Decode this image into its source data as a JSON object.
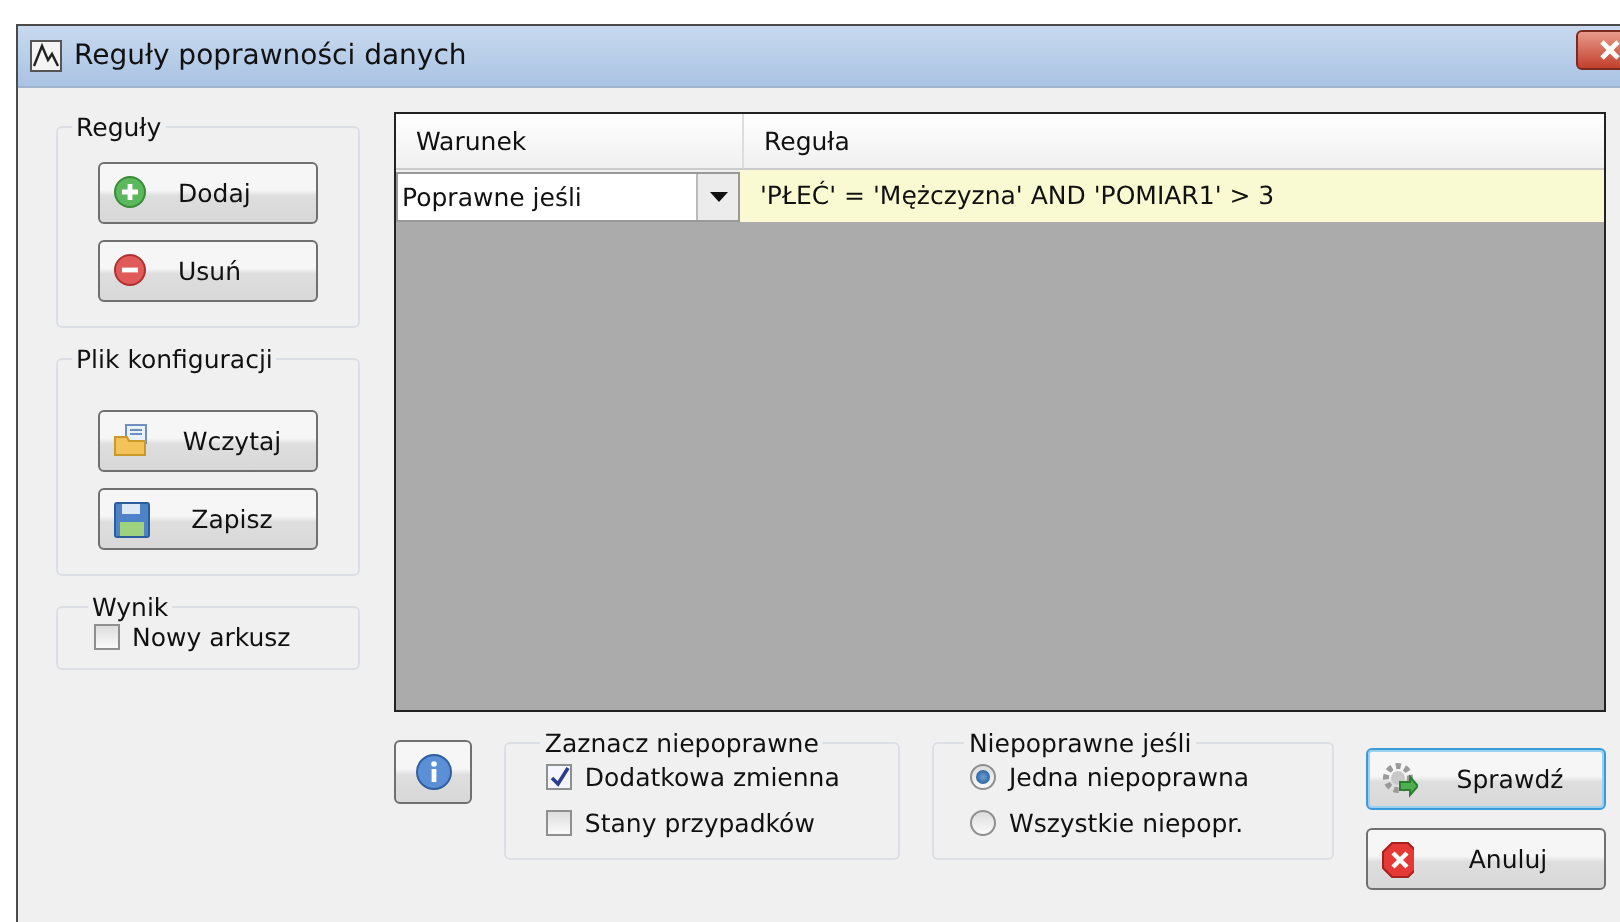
{
  "window": {
    "title": "Reguły poprawności danych"
  },
  "rules_group": {
    "title": "Reguły",
    "buttons": [
      {
        "label": "Dodaj",
        "kind": "add"
      },
      {
        "label": "Usuń",
        "kind": "remove"
      }
    ]
  },
  "config_group": {
    "title": "Plik konfiguracji",
    "buttons": [
      {
        "label": "Wczytaj",
        "kind": "open"
      },
      {
        "label": "Zapisz",
        "kind": "save"
      }
    ]
  },
  "result_group": {
    "title": "Wynik",
    "checkbox": {
      "label": "Nowy arkusz",
      "checked": false
    }
  },
  "grid": {
    "columns": [
      "Warunek",
      "Reguła"
    ],
    "rows": [
      {
        "condition": "Poprawne jeśli",
        "rule": "'PŁEĆ' = 'Mężczyzna' AND 'POMIAR1' > 3",
        "selected": true
      }
    ]
  },
  "mark_group": {
    "title": "Zaznacz niepoprawne",
    "options": [
      {
        "label": "Dodatkowa zmienna",
        "checked": true
      },
      {
        "label": "Stany przypadków",
        "checked": false
      }
    ]
  },
  "invalid_if": {
    "title": "Niepoprawne jeśli",
    "options": [
      {
        "label": "Jedna niepoprawna",
        "selected": true
      },
      {
        "label": "Wszystkie niepopr.",
        "selected": false
      }
    ]
  },
  "actions": [
    {
      "label": "Sprawdź",
      "kind": "check",
      "focused": true
    },
    {
      "label": "Anuluj",
      "kind": "cancel",
      "focused": false
    }
  ]
}
